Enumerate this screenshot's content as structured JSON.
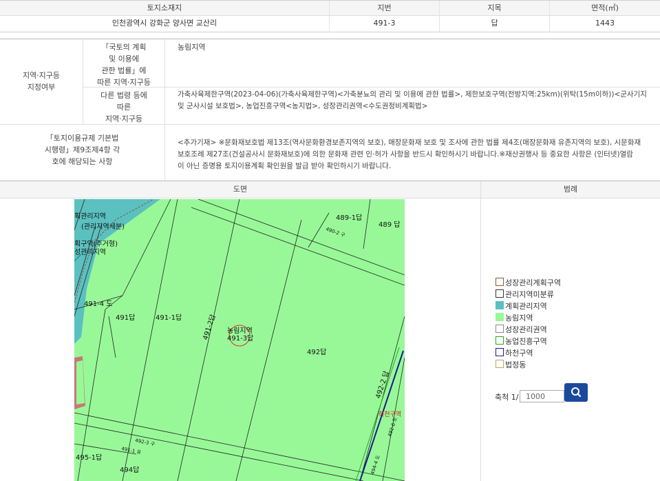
{
  "land_table": {
    "headers": {
      "location": "토지소재지",
      "lot_number": "지번",
      "land_category": "지목",
      "area": "면적(㎡)"
    },
    "row": {
      "location": "인천광역시 강화군 양사면 교산리",
      "lot_number": "491-3",
      "land_category": "답",
      "area": "1443"
    }
  },
  "zoning": {
    "group_label": [
      "지역·지구등",
      "지정여부"
    ],
    "national_law_label": [
      "「국토의 계획",
      "및 이용에",
      "관한 법률」에",
      "따른 지역·지구등"
    ],
    "national_law_value": "농림지역",
    "other_law_label": [
      "다른 법령 등에",
      "따른",
      "지역·지구등"
    ],
    "other_law_value": [
      "가축사육제한구역(2023-04-06)(가축사육제한구역)<가축분뇨의 관리 및 이용에 관한 법률>, 제한보호구역(전방지역:25km)(위탁(15m이하))<군사기지",
      "및 군사시설 보호법>, 농업진흥구역<농지법>, 성장관리권역<수도권정비계획법>"
    ],
    "regulation_label": [
      "「토지이용규제 기본법",
      "시행령」제9조제4항 각",
      "호에 해당되는 사항"
    ],
    "regulation_value": [
      "<추가기재> ※문화재보호법 제13조(역사문화환경보존지역의 보호), 매장문화재 보호 및 조사에 관한 법률 제4조(매장문화재 유존지역의 보호), 시문화재",
      "보호조례 제27조(건설공사시 문화재보호)에 의한 문화재 관련 인·허가 사항을 반드시 확인하시기 바랍니다.※재산권행사 등 중요한 사항은 (인터넷)열람",
      "이 아닌 증명용 토지이용계획 확인원을 발급 받아 확인하시기 바랍니다."
    ]
  },
  "map_header": {
    "drawing": "도면",
    "legend": "범례"
  },
  "map_labels": {
    "mgmt_top": "획관리지역",
    "mgmt_top2": "(관리지역세분)",
    "gr_district": "획구역(주거형)",
    "gr_mgmt": "성관리지역",
    "p489_1": "489-1답",
    "p489": "489 답",
    "p491_4": "491-4 도",
    "p491": "491답",
    "p491_1": "491-1답",
    "p491_2": "491-2답",
    "selected_zone": "농림지역",
    "selected_lot": "491-3답",
    "p492": "492답",
    "p492_2": "492-2 답",
    "p495_1": "495-1답",
    "p494": "494답",
    "road_1": "490-2 구",
    "road_2": "492-3 구",
    "road_3": "491-1 유",
    "road_4": "492-6 도",
    "road_5": "494-4 도",
    "edge_red": "하천구역"
  },
  "legend": [
    {
      "label": "성장관리계획구역",
      "fill": "#ffffff",
      "border": "#8b5a2b"
    },
    {
      "label": "관리지역미분류",
      "fill": "#ffffff",
      "border": "#333333"
    },
    {
      "label": "계획관리지역",
      "fill": "#5bc0c0",
      "border": "#5bc0c0"
    },
    {
      "label": "농림지역",
      "fill": "#98f898",
      "border": "#98f898"
    },
    {
      "label": "성장관리권역",
      "fill": "#ffffff",
      "border": "#888888"
    },
    {
      "label": "농업진흥구역",
      "fill": "#ffffff",
      "border": "#22aa22"
    },
    {
      "label": "하천구역",
      "fill": "#ffffff",
      "border": "#1a1a8c"
    },
    {
      "label": "법정동",
      "fill": "#ffffff",
      "border": "#c8a060"
    }
  ],
  "scale": {
    "label": "축척 1/",
    "value": "1000"
  },
  "colors": {
    "farmland": "#98f898",
    "planning": "#5bc0c0",
    "accent": "#1a4a9c"
  }
}
